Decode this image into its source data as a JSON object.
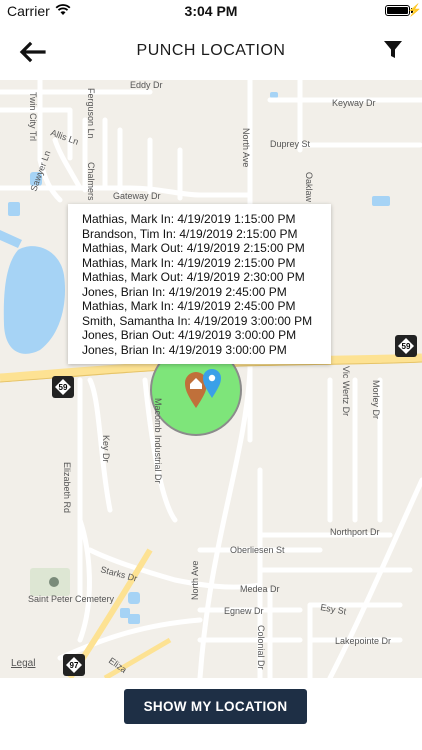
{
  "status_bar": {
    "carrier": "Carrier",
    "time": "3:04 PM"
  },
  "header": {
    "title": "PUNCH LOCATION",
    "back_icon": "back-arrow-icon",
    "filter_icon": "filter-funnel-icon"
  },
  "map": {
    "streets": [
      "Eddy Dr",
      "Keyway Dr",
      "Twin City Trl",
      "Ferguson Ln",
      "Allis Ln",
      "North Ave",
      "Duprey St",
      "Sawyer Ln",
      "Chalmers",
      "Oaklaw",
      "Gateway Dr",
      "Vic Wertz Dr",
      "Morley Dr",
      "Macomb Industrial Dr",
      "Key Dr",
      "Elizabeth Rd",
      "Northport Dr",
      "Oberliesen St",
      "Starks Dr",
      "Saint Peter Cemetery",
      "Medea Dr",
      "Egnew Dr",
      "Esy St",
      "Colonial Dr",
      "Lakepointe Dr",
      "Eliza"
    ],
    "route_shields": [
      "59",
      "59",
      "97"
    ],
    "legal": "Legal",
    "geofence_color": "#7ee57a",
    "markers": [
      "home-marker-icon",
      "location-pin-icon"
    ]
  },
  "punches": [
    "Mathias, Mark In: 4/19/2019 1:15:00 PM",
    "Brandson, Tim In: 4/19/2019 2:15:00 PM",
    "Mathias, Mark Out: 4/19/2019 2:15:00 PM",
    "Mathias, Mark In: 4/19/2019 2:15:00 PM",
    "Mathias, Mark Out: 4/19/2019 2:30:00 PM",
    "Jones, Brian In: 4/19/2019 2:45:00 PM",
    "Mathias, Mark In: 4/19/2019 2:45:00 PM",
    "Smith, Samantha In: 4/19/2019 3:00:00 PM",
    "Jones, Brian Out: 4/19/2019 3:00:00 PM",
    "Jones, Brian In: 4/19/2019 3:00:00 PM"
  ],
  "actions": {
    "show_location": "SHOW MY LOCATION"
  },
  "colors": {
    "button_bg": "#1e2f45",
    "map_bg": "#f2efe9",
    "water": "#a6d3f5",
    "road": "#ffffff",
    "highway": "#fde293",
    "home_marker": "#c0703a",
    "pin": "#3aa0e8"
  }
}
